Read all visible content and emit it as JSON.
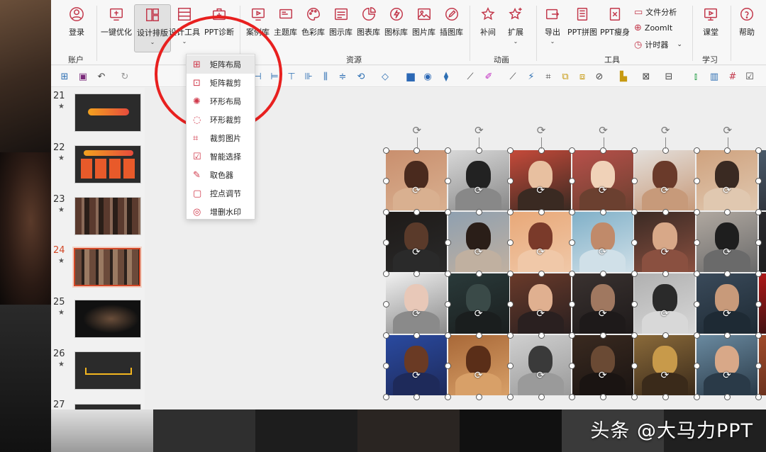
{
  "ribbon": {
    "login": "登录",
    "one_click": "一键优化",
    "design_layout": "设计排版",
    "design_tools": "设计工具",
    "ppt_diagnose": "PPT诊断",
    "case_lib": "案例库",
    "theme_lib": "主题库",
    "color_lib": "色彩库",
    "diagram_lib": "图示库",
    "chart_lib": "图表库",
    "icon_lib": "图标库",
    "image_lib": "图片库",
    "illus_lib": "插图库",
    "tween": "补间",
    "expand": "扩展",
    "export": "导出",
    "ppt_merge": "PPT拼图",
    "ppt_slim": "PPT瘦身",
    "file_analysis": "文件分析",
    "zoomit": "ZoomIt",
    "timer": "计时器",
    "classroom": "课堂",
    "help": "帮助",
    "groups": {
      "account": "账户",
      "resources": "资源",
      "animation": "动画",
      "tools": "工具",
      "learning": "学习"
    }
  },
  "dropdown": {
    "items": [
      "矩阵布局",
      "矩阵裁剪",
      "环形布局",
      "环形裁剪",
      "裁剪图片",
      "智能选择",
      "取色器",
      "控点调节",
      "增删水印"
    ]
  },
  "slides": {
    "numbers": [
      "21",
      "22",
      "23",
      "24",
      "25",
      "26",
      "27"
    ],
    "current": "24",
    "star": "★"
  },
  "watermark": "头条 @大马力PPT",
  "colors": {
    "accent": "#c2374a",
    "selection_red": "#e8201f",
    "current_slide": "#d24726"
  }
}
